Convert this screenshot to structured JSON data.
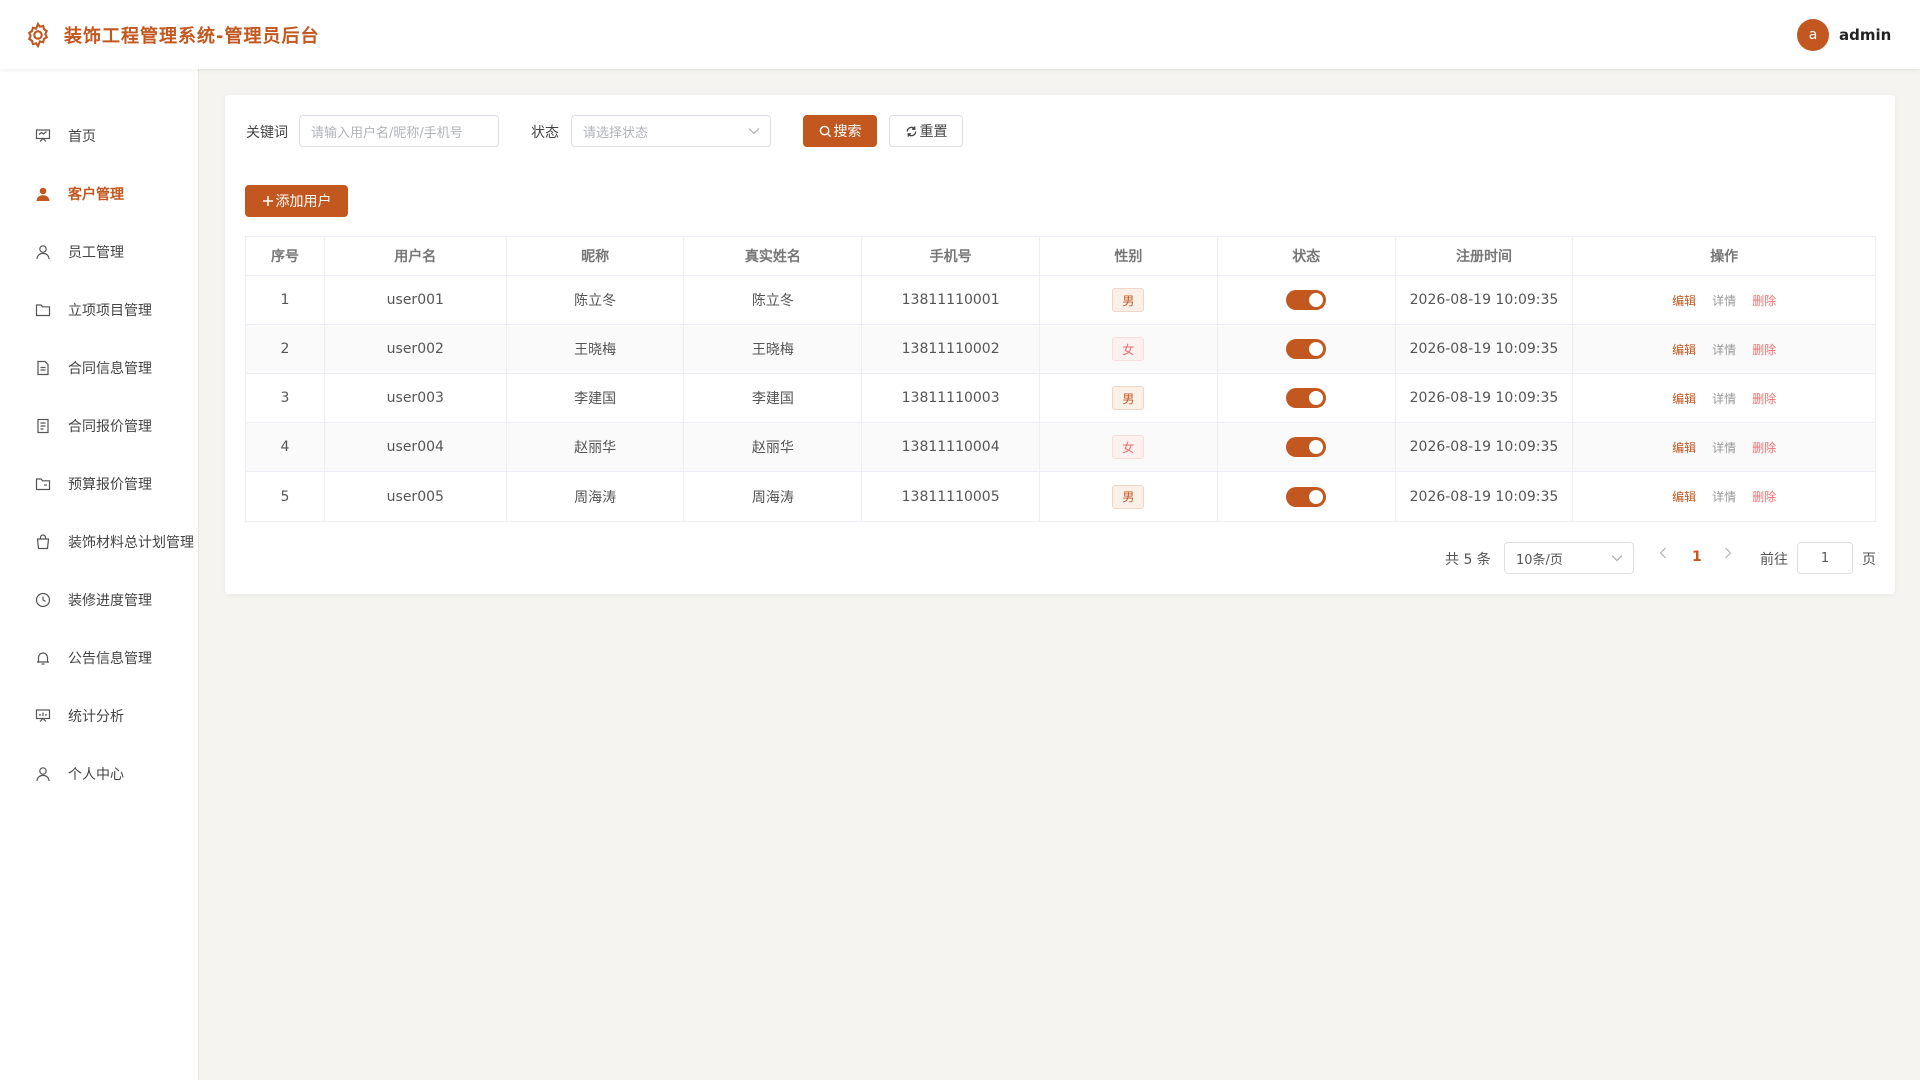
{
  "header": {
    "title": "装饰工程管理系统-管理员后台",
    "avatar_letter": "a",
    "username": "admin",
    "logo_icon": "gear-icon"
  },
  "sidebar": {
    "items": [
      {
        "label": "首页",
        "icon": "presentation-icon",
        "active": false
      },
      {
        "label": "客户管理",
        "icon": "user-filled-icon",
        "active": true
      },
      {
        "label": "员工管理",
        "icon": "user-icon",
        "active": false
      },
      {
        "label": "立项项目管理",
        "icon": "folder-icon",
        "active": false
      },
      {
        "label": "合同信息管理",
        "icon": "document-icon",
        "active": false
      },
      {
        "label": "合同报价管理",
        "icon": "tickets-icon",
        "active": false
      },
      {
        "label": "预算报价管理",
        "icon": "folder-open-icon",
        "active": false
      },
      {
        "label": "装饰材料总计划管理",
        "icon": "shopping-bag-icon",
        "active": false
      },
      {
        "label": "装修进度管理",
        "icon": "clock-icon",
        "active": false
      },
      {
        "label": "公告信息管理",
        "icon": "bell-icon",
        "active": false
      },
      {
        "label": "统计分析",
        "icon": "chart-board-icon",
        "active": false
      },
      {
        "label": "个人中心",
        "icon": "user-icon",
        "active": false
      }
    ]
  },
  "filters": {
    "keyword_label": "关键词",
    "keyword_placeholder": "请输入用户名/昵称/手机号",
    "status_label": "状态",
    "status_placeholder": "请选择状态",
    "search_label": "搜索",
    "reset_label": "重置"
  },
  "toolbar": {
    "add_label": "添加用户"
  },
  "table": {
    "columns": [
      "序号",
      "用户名",
      "昵称",
      "真实姓名",
      "手机号",
      "性别",
      "状态",
      "注册时间",
      "操作"
    ],
    "rows": [
      {
        "index": "1",
        "username": "user001",
        "nickname": "陈立冬",
        "realname": "陈立冬",
        "phone": "13811110001",
        "gender": "男",
        "enabled": true,
        "time": "2026-08-19 10:09:35"
      },
      {
        "index": "2",
        "username": "user002",
        "nickname": "王晓梅",
        "realname": "王晓梅",
        "phone": "13811110002",
        "gender": "女",
        "enabled": true,
        "time": "2026-08-19 10:09:35"
      },
      {
        "index": "3",
        "username": "user003",
        "nickname": "李建国",
        "realname": "李建国",
        "phone": "13811110003",
        "gender": "男",
        "enabled": true,
        "time": "2026-08-19 10:09:35"
      },
      {
        "index": "4",
        "username": "user004",
        "nickname": "赵丽华",
        "realname": "赵丽华",
        "phone": "13811110004",
        "gender": "女",
        "enabled": true,
        "time": "2026-08-19 10:09:35"
      },
      {
        "index": "5",
        "username": "user005",
        "nickname": "周海涛",
        "realname": "周海涛",
        "phone": "13811110005",
        "gender": "男",
        "enabled": true,
        "time": "2026-08-19 10:09:35"
      }
    ],
    "actions": {
      "edit": "编辑",
      "detail": "详情",
      "delete": "删除"
    }
  },
  "pagination": {
    "total_text": "共 5 条",
    "page_size": "10条/页",
    "current_page": "1",
    "goto_label": "前往",
    "goto_value": "1",
    "page_suffix": "页"
  },
  "colors": {
    "accent": "#c2571f",
    "danger": "#f07070",
    "background": "#f5f4f1"
  }
}
